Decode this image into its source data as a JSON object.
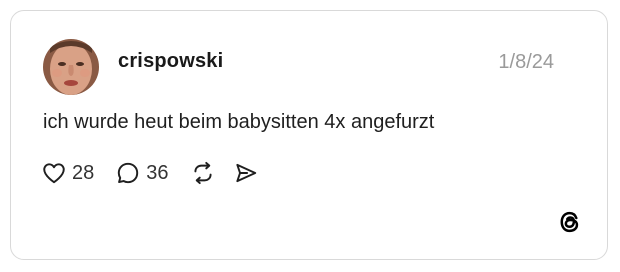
{
  "post": {
    "username": "crispowski",
    "date": "1/8/24",
    "text": "ich wurde heut beim babysitten 4x angefurzt",
    "likes": "28",
    "replies": "36"
  },
  "icons": {
    "like": "heart-icon",
    "reply": "speech-bubble-icon",
    "repost": "repost-arrows-icon",
    "share": "send-icon",
    "brand": "threads-logo-icon"
  },
  "colors": {
    "border": "#d9d9d9",
    "text": "#1f1f1f",
    "date": "#9a9a9a"
  }
}
